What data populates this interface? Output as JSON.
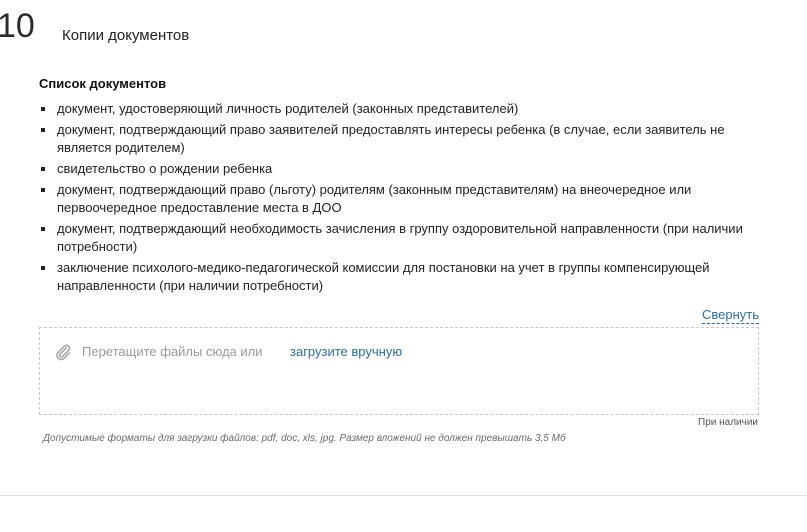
{
  "step": {
    "number": "10",
    "title": "Копии документов"
  },
  "documents": {
    "heading": "Список документов",
    "items": [
      "документ, удостоверяющий личность родителей (законных представителей)",
      "документ, подтверждающий право заявителей предоставлять интересы ребенка (в случае, если заявитель не является родителем)",
      "свидетельство о рождении ребенка",
      "документ, подтверждающий право (льготу) родителям (законным представителям) на внеочередное или первоочередное предоставление места в ДОО",
      "документ, подтверждающий необходимость зачисления в группу оздоровительной направленности (при наличии потребности)",
      "заключение психолого-медико-педагогической комиссии для постановки на учет в группы компенсирующей направленности (при наличии потребности)"
    ],
    "collapse_label": "Свернуть"
  },
  "upload": {
    "icon": "paperclip-icon",
    "drop_text": "Перетащите файлы сюда или",
    "manual_link": "загрузите вручную",
    "requirement": "При наличии",
    "formats_hint": "Допустимые форматы для загрузки файлов: pdf, doc, xls, jpg. Размер вложений не должен превышать 3,5 Мб"
  },
  "colors": {
    "link": "#2a6fa8",
    "muted": "#9a9a9a",
    "border": "#c8c8c8"
  }
}
